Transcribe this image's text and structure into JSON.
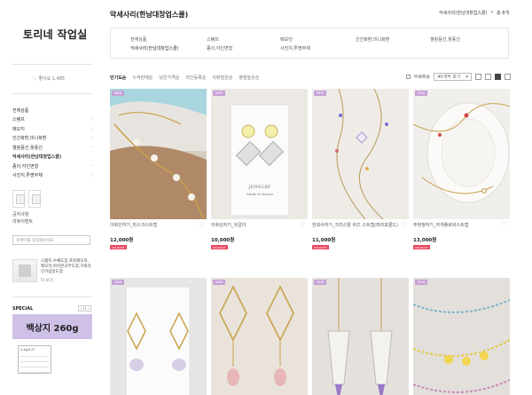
{
  "sidebar": {
    "shop_name": "토리네 작업실",
    "likes": "좋아요 1,485",
    "menu": [
      {
        "label": "전체상품",
        "arrow": ""
      },
      {
        "label": "스탬프",
        "arrow": "›"
      },
      {
        "label": "메모지",
        "arrow": "›"
      },
      {
        "label": "인간화환,미니화환",
        "arrow": "›"
      },
      {
        "label": "웰컴풍선,꽃풍선",
        "arrow": "›"
      },
      {
        "label": "악세사리(한남대창업스쿨)",
        "arrow": ""
      },
      {
        "label": "종이,각인변형",
        "arrow": "›"
      },
      {
        "label": "사진지,투명부채",
        "arrow": "›"
      }
    ],
    "links": [
      "공지사항",
      "리뷰이벤트"
    ],
    "search_placeholder": "검색어를 입력해보세요",
    "promo": {
      "text": "스탬프,수채도장,포토메모지,메모잇,아이콘고무도장,가죽각인기념일도장",
      "more": "더 보기"
    },
    "special_label": "SPECIAL",
    "special_prev": "‹",
    "special_next": "›",
    "special_banner": "백상지 260g",
    "special_card_title": "0.4g/0.2T"
  },
  "main": {
    "category_title": "악세사리(한남대창업스쿨)",
    "sort_value": "악세사리(한남대창업스쿨)",
    "sort_chevron": "▾",
    "sort_count": "총 8개",
    "sub_cats": [
      {
        "l1": "전체상품",
        "l2": "악세사리(한남대창업스쿨)"
      },
      {
        "l1": "스탬프",
        "l2": "종이,각인변형"
      },
      {
        "l1": "메모잇",
        "l2": "사진지,투명부채"
      },
      {
        "l1": "인간화환,미니화환",
        "l2": ""
      },
      {
        "l1": "웰컴풍선,꽃풍선",
        "l2": ""
      }
    ],
    "filter_tabs": [
      "인기도순",
      "누적판매순",
      "낮은가격순",
      "최신등록순",
      "리뷰많은순",
      "평점높은순"
    ],
    "view": {
      "checkbox_label": "무료배송",
      "per_page": "40개씩 보기",
      "per_page_chevron": "▾"
    },
    "products": [
      {
        "name": "이화인하기_마스크스트랩",
        "price": "12,000원",
        "badge": "NEW",
        "tag": "SOLDOUT"
      },
      {
        "name": "이화성자기_귀걸이",
        "price": "10,000원",
        "badge": "NEW",
        "tag": "SOLDOUT"
      },
      {
        "name": "한회수하기_크리스탈 비즈 스트랩(파라모콜드)",
        "price": "11,000원",
        "badge": "NEW",
        "tag": "SOLDOUT"
      },
      {
        "name": "주현정하기_자개플로비스트랩",
        "price": "13,000원",
        "badge": "NEW",
        "tag": "SOLDOUT"
      },
      {
        "name": "",
        "price": "",
        "badge": "NEW",
        "tag": ""
      },
      {
        "name": "",
        "price": "",
        "badge": "NEW",
        "tag": ""
      },
      {
        "name": "",
        "price": "",
        "badge": "NEW",
        "tag": ""
      },
      {
        "name": "",
        "price": "",
        "badge": "NEW",
        "tag": ""
      }
    ]
  }
}
